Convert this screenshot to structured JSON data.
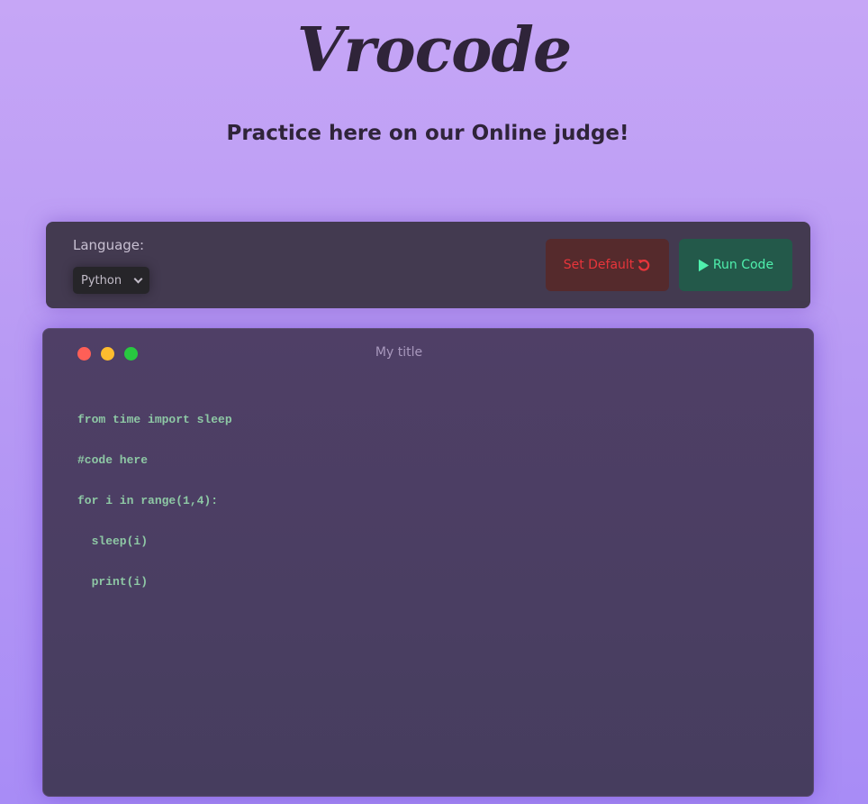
{
  "header": {
    "logo": "Vrocode",
    "subtitle": "Practice here on our Online judge!"
  },
  "toolbar": {
    "language_label": "Language:",
    "language_selected": "Python",
    "set_default_label": "Set Default",
    "set_default_icon": "undo-icon",
    "run_label": "Run Code",
    "run_icon": "play-icon"
  },
  "editor": {
    "title": "My title",
    "code_lines": [
      "from time import sleep",
      "#code here",
      "for i in range(1,4):",
      "  sleep(i)",
      "  print(i)"
    ]
  },
  "colors": {
    "page_background": "#c6a6f6",
    "toolbar_background": "#433a50",
    "editor_background": "#4a3e62",
    "logo_text": "#2f2439",
    "set_default_bg": "#552a2c",
    "set_default_text": "#e8353b",
    "run_bg": "#23594a",
    "run_text": "#4ff0ad",
    "code_text": "#8ec8a5",
    "window_dot_red": "#ff5f57",
    "window_dot_yellow": "#febc2e",
    "window_dot_green": "#28c840"
  }
}
